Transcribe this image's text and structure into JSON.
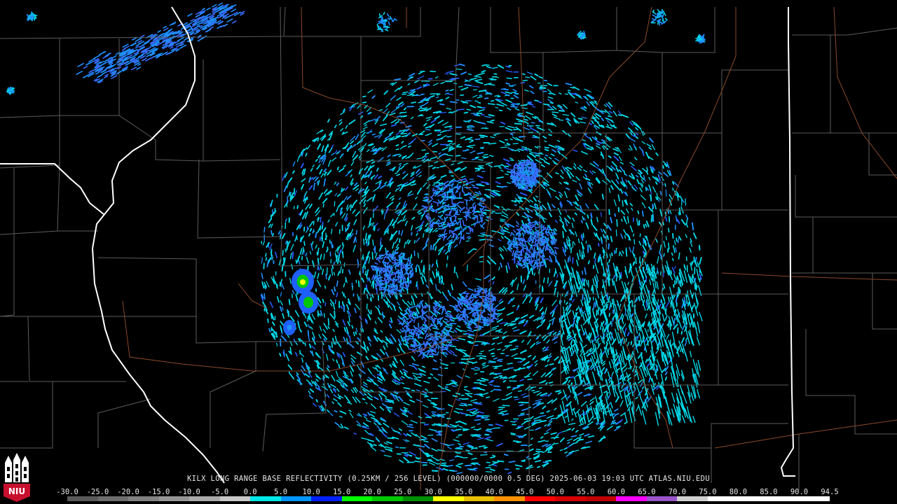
{
  "header": {
    "title": "KILX LONG RANGE BASE REFLECTIVITY (0.25KM / 256 LEVEL) (000000/0000 0.5 DEG) 2025-06-03 19:03 UTC  ATLAS.NIU.EDU"
  },
  "legend": {
    "labels": [
      "-30.0",
      "-25.0",
      "-20.0",
      "-15.0",
      "-10.0",
      "-5.0",
      "0.0",
      "5.0",
      "10.0",
      "15.0",
      "20.0",
      "25.0",
      "30.0",
      "35.0",
      "40.0",
      "45.0",
      "50.0",
      "55.0",
      "60.0",
      "65.0",
      "70.0",
      "75.0",
      "80.0",
      "85.0",
      "90.0",
      "94.5"
    ],
    "colors": [
      "#5a5a5a",
      "#6e6e6e",
      "#828282",
      "#969696",
      "#aaaaaa",
      "#c8c8c8",
      "#00e8e8",
      "#0096ff",
      "#0020ff",
      "#00ff00",
      "#00c800",
      "#009000",
      "#ffff00",
      "#e7c000",
      "#ff9000",
      "#ff0000",
      "#d60000",
      "#c00000",
      "#ff00ff",
      "#9955c9",
      "#d0d0d0",
      "#ffffff",
      "#ffffff",
      "#ffffff",
      "#ffffff"
    ]
  },
  "logo": {
    "text": "NIU"
  },
  "colors": {
    "background": "#000000",
    "county_lines": "#5c5c5c",
    "state_lines": "#ffffff",
    "highways": "#8a4a2a"
  }
}
